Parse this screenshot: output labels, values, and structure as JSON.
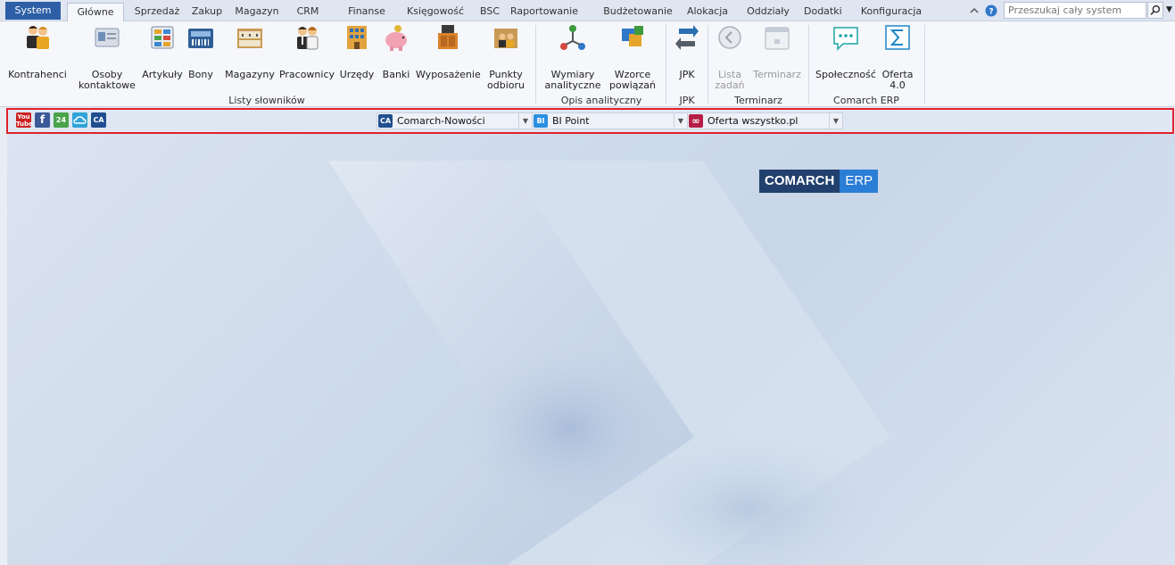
{
  "menu": {
    "tabs": [
      "System",
      "Główne",
      "Sprzedaż",
      "Zakup",
      "Magazyn",
      "CRM",
      "Finanse",
      "Księgowość",
      "BSC",
      "Raportowanie",
      "Budżetowanie",
      "Alokacja",
      "Oddziały",
      "Dodatki",
      "Konfiguracja"
    ],
    "active_tab": "Główne",
    "search_placeholder": "Przeszukaj cały system"
  },
  "ribbon": {
    "buttons": {
      "kontrahenci": "Kontrahenci",
      "osoby": [
        "Osoby",
        "kontaktowe"
      ],
      "artykuly": "Artykuły",
      "bony": "Bony",
      "magazyny": "Magazyny",
      "pracownicy": "Pracownicy",
      "urzedy": "Urzędy",
      "banki": "Banki",
      "wyposazenie": "Wyposażenie",
      "punkty": [
        "Punkty",
        "odbioru"
      ],
      "wymiary": [
        "Wymiary",
        "analityczne"
      ],
      "wzorce": [
        "Wzorce",
        "powiązań"
      ],
      "jpk": "JPK",
      "lista": [
        "Lista",
        "zadań"
      ],
      "terminarz": "Terminarz",
      "spolecznosc": "Społeczność",
      "oferta": [
        "Oferta",
        "4.0"
      ]
    },
    "groups": {
      "listy": "Listy słowników",
      "opis": "Opis analityczny",
      "jpk": "JPK",
      "terminarz": "Terminarz",
      "comarch": "Comarch ERP"
    }
  },
  "quickbar": {
    "icons": [
      "youtube-icon",
      "facebook-icon",
      "comarch24-icon",
      "cloud-icon",
      "ca-icon"
    ],
    "combo1": {
      "icon_text": "CA",
      "label": "Comarch-Nowości"
    },
    "combo2": {
      "icon_text": "BI",
      "label": "BI Point"
    },
    "combo3": {
      "icon_text": "∞",
      "label": "Oferta wszystko.pl"
    }
  },
  "brand": {
    "part1": "COMARCH",
    "part2": "ERP"
  },
  "colors": {
    "system_tab": "#2c5fa6",
    "highlight": "#e0212b",
    "brand_dark": "#22406d",
    "brand_light": "#2b7ed6"
  }
}
